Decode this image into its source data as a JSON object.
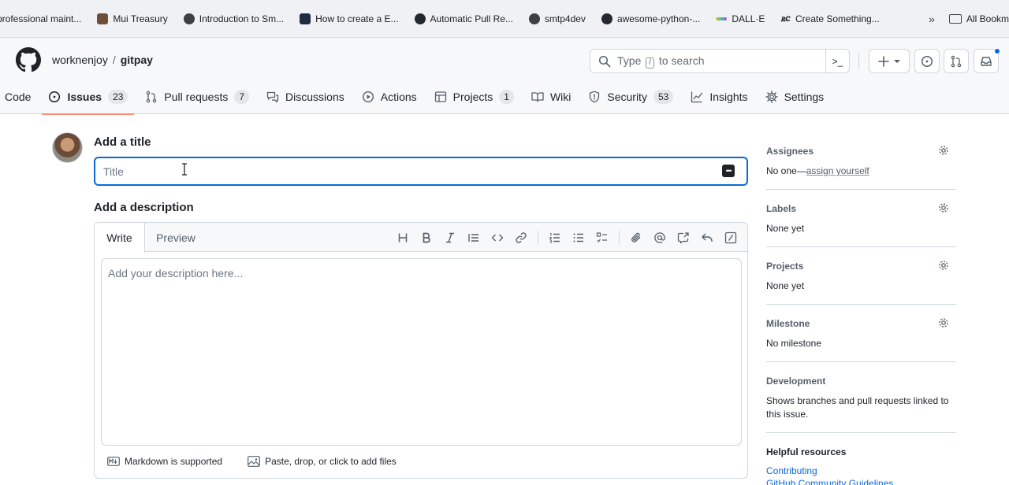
{
  "bookmarks": {
    "items": [
      {
        "label": "professional maint...",
        "icon_color": "#d9d9d9"
      },
      {
        "label": "Mui Treasury",
        "icon_color": "#6b4f3a"
      },
      {
        "label": "Introduction to Sm...",
        "icon_color": "#3c4043"
      },
      {
        "label": "How to create a E...",
        "icon_color": "#1f2a44"
      },
      {
        "label": "Automatic Pull Re...",
        "icon_color": "#24292f"
      },
      {
        "label": "smtp4dev",
        "icon_color": "#3c4043"
      },
      {
        "label": "awesome-python-...",
        "icon_color": "#24292f"
      },
      {
        "label": "DALL·E",
        "icon_color": "#e6c34a"
      },
      {
        "label": "Create Something...",
        "icon_color": "#ffffff"
      }
    ],
    "more": "»",
    "all_bookmarks": "All Bookm"
  },
  "repo": {
    "owner": "worknenjoy",
    "separator": "/",
    "name": "gitpay"
  },
  "search": {
    "prefix": "Type",
    "key": "/",
    "suffix": "to search"
  },
  "tabs": [
    {
      "label": "Code",
      "icon": "code-icon"
    },
    {
      "label": "Issues",
      "count": "23",
      "icon": "issue-icon",
      "active": true
    },
    {
      "label": "Pull requests",
      "count": "7",
      "icon": "pull-request-icon"
    },
    {
      "label": "Discussions",
      "icon": "discussion-icon"
    },
    {
      "label": "Actions",
      "icon": "play-icon"
    },
    {
      "label": "Projects",
      "count": "1",
      "icon": "table-icon"
    },
    {
      "label": "Wiki",
      "icon": "book-icon"
    },
    {
      "label": "Security",
      "count": "53",
      "icon": "shield-icon"
    },
    {
      "label": "Insights",
      "icon": "graph-icon"
    },
    {
      "label": "Settings",
      "icon": "gear-icon"
    }
  ],
  "form": {
    "title_heading": "Add a title",
    "title_placeholder": "Title",
    "title_value": "",
    "description_heading": "Add a description",
    "write_tab": "Write",
    "preview_tab": "Preview",
    "description_placeholder": "Add your description here...",
    "markdown_note": "Markdown is supported",
    "attach_note": "Paste, drop, or click to add files"
  },
  "sidebar": {
    "assignees": {
      "title": "Assignees",
      "value_prefix": "No one—",
      "link": "assign yourself"
    },
    "labels": {
      "title": "Labels",
      "value": "None yet"
    },
    "projects": {
      "title": "Projects",
      "value": "None yet"
    },
    "milestone": {
      "title": "Milestone",
      "value": "No milestone"
    },
    "development": {
      "title": "Development",
      "value": "Shows branches and pull requests linked to this issue."
    },
    "helpful": {
      "title": "Helpful resources",
      "links": [
        "Contributing",
        "GitHub Community Guidelines"
      ]
    }
  },
  "colors": {
    "accent": "#0969da",
    "active_tab_underline": "#fd8c73",
    "header_bg": "#f6f8fa"
  }
}
